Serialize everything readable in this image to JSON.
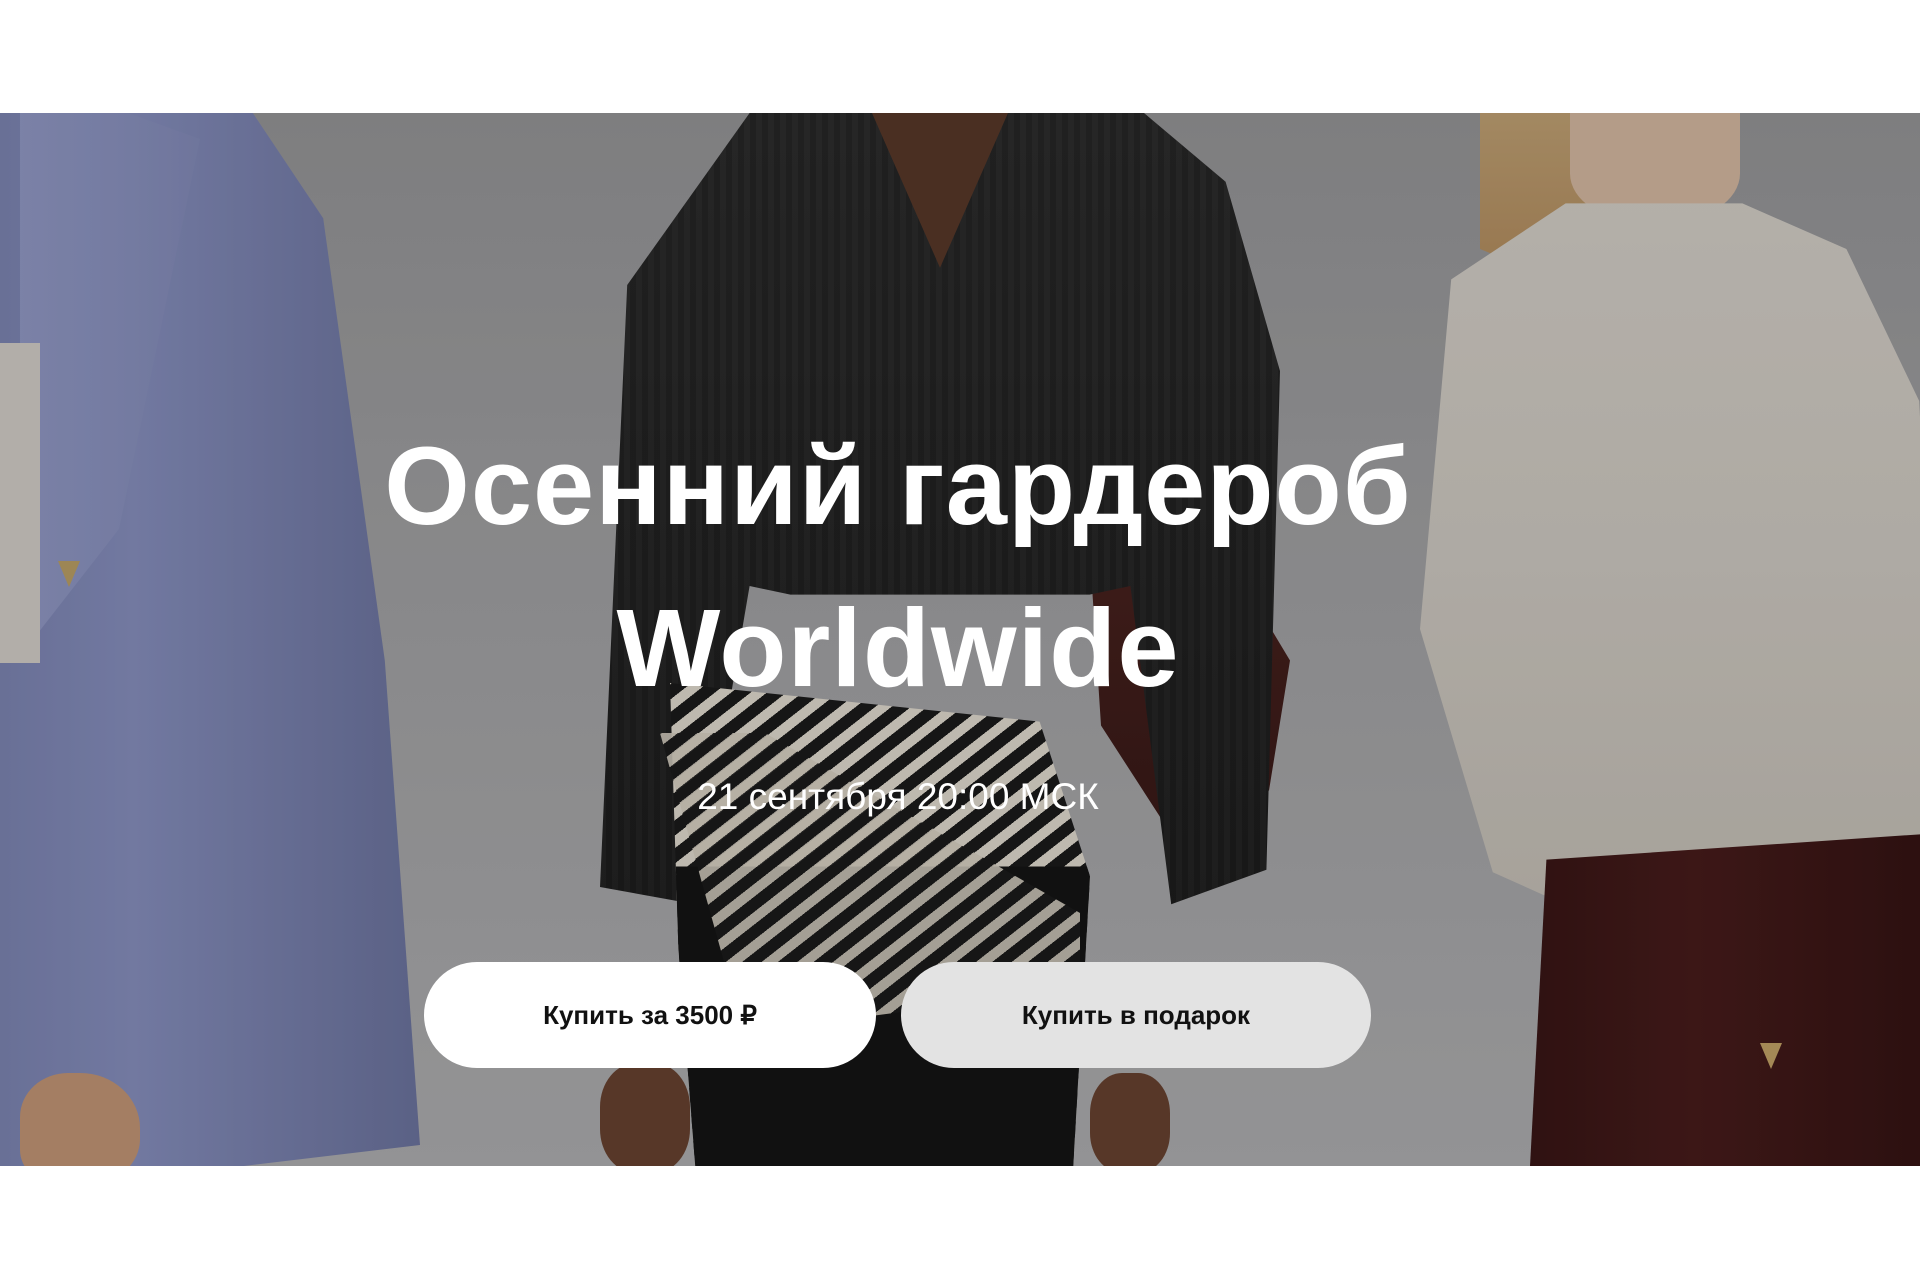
{
  "hero": {
    "title_line1": "Осенний гардероб",
    "title_line2": "Worldwide",
    "date": "21 сентября 20:00 МСК"
  },
  "actions": {
    "buy_label": "Купить за 3500 ₽",
    "gift_label": "Купить в подарок"
  },
  "colors": {
    "page_background": "#ffffff",
    "title_text": "#ffffff",
    "primary_button_bg": "#ffffff",
    "secondary_button_bg": "#e3e3e3",
    "button_text": "#111111"
  }
}
